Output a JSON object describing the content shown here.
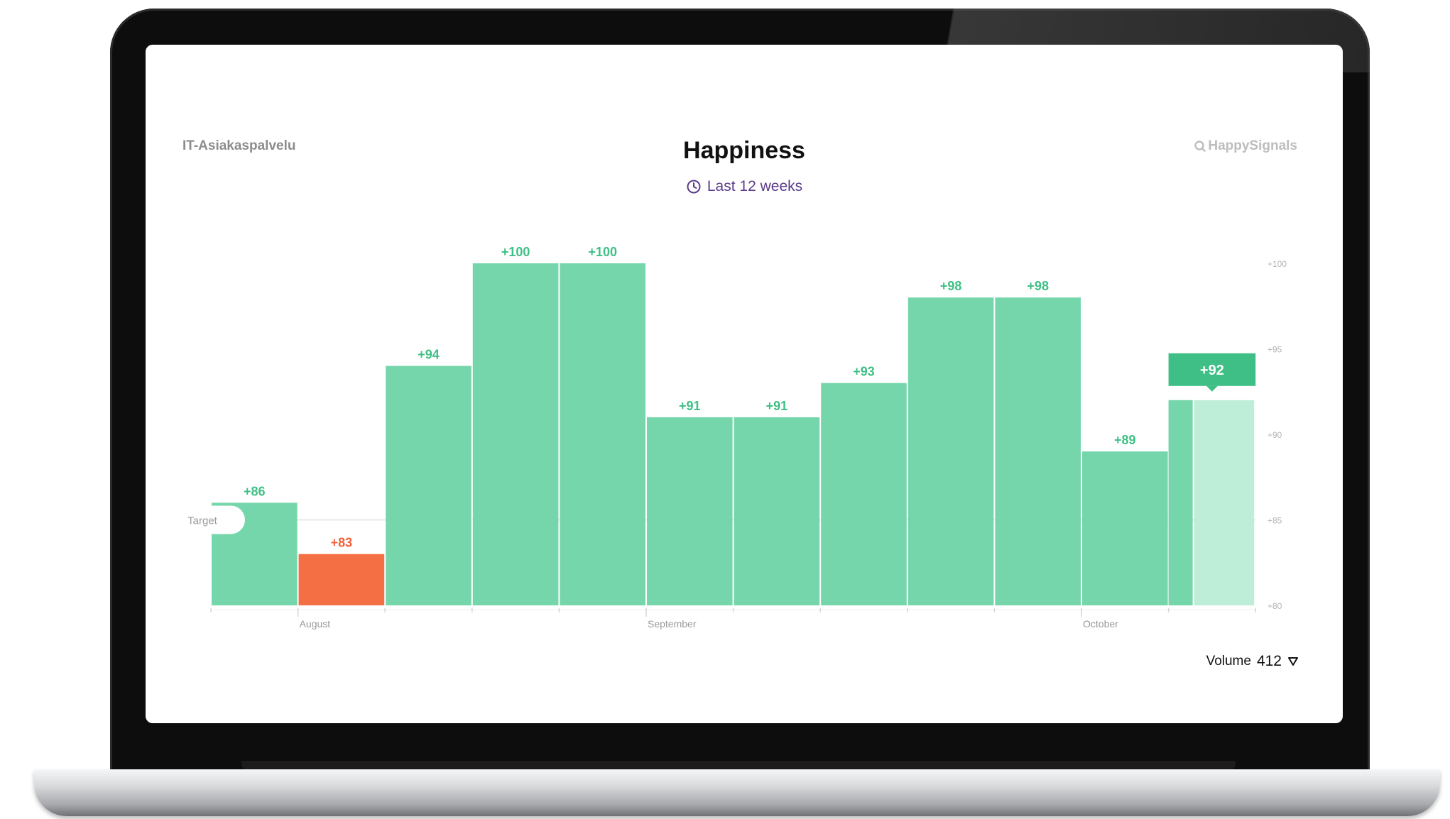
{
  "header": {
    "org_name": "IT-Asiakaspalvelu",
    "title": "Happiness",
    "period": "Last 12 weeks",
    "brand": "HappySignals"
  },
  "footer": {
    "volume_label": "Volume",
    "volume_value": "412"
  },
  "colors": {
    "bar_ok": "#76d6ab",
    "bar_below_target": "#f56f45",
    "bar_partial": "#bfeed8",
    "label_ok": "#3fbf85",
    "label_below_target": "#f0603a",
    "title_accent": "#5b3c8a"
  },
  "chart_data": {
    "type": "bar",
    "title": "Happiness",
    "categories": [
      "",
      "August",
      "",
      "",
      "",
      "September",
      "",
      "",
      "",
      "",
      "October",
      ""
    ],
    "x_month_labels": [
      "August",
      "September",
      "October"
    ],
    "values": [
      86,
      83,
      94,
      100,
      100,
      91,
      91,
      93,
      98,
      98,
      89,
      92
    ],
    "value_labels": [
      "+86",
      "+83",
      "+94",
      "+100",
      "+100",
      "+91",
      "+91",
      "+93",
      "+98",
      "+98",
      "+89",
      "+92"
    ],
    "below_target": [
      false,
      true,
      false,
      false,
      false,
      false,
      false,
      false,
      false,
      false,
      false,
      false
    ],
    "current_week_partial": true,
    "target": {
      "label": "Target",
      "value": 85
    },
    "ylim": [
      80,
      100
    ],
    "y_ticks": [
      80,
      85,
      90,
      95,
      100
    ],
    "y_tick_labels": [
      "+80",
      "+85",
      "+90",
      "+95",
      "+100"
    ],
    "grid": false,
    "legend": "none"
  }
}
